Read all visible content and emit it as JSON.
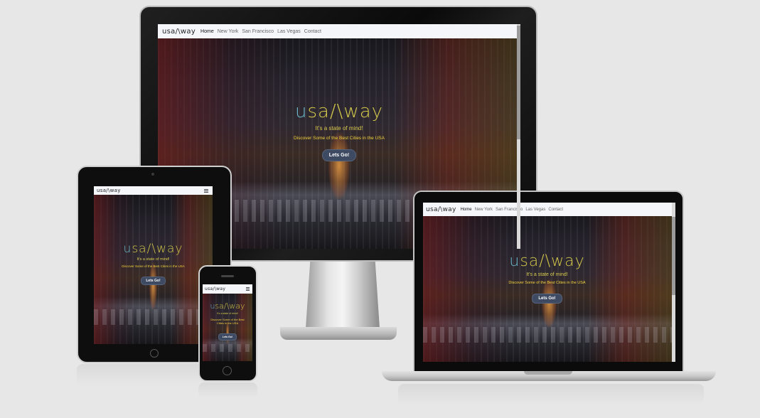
{
  "site": {
    "brand": "usa/\\way",
    "brand_prefix": "u",
    "brand_rest": "sa/\\way",
    "nav": [
      "Home",
      "New York",
      "San Francisco",
      "Las Vegas",
      "Contact"
    ],
    "hero": {
      "title_prefix": "u",
      "title_rest": "sa/\\way",
      "tagline": "It's a state of mind!",
      "discover": "Discover Some of the Best Cities in the USA",
      "discover_phone": "Discover Some of the Best Cities in the USA",
      "cta": "Lets Go!"
    }
  },
  "colors": {
    "accent_title": "#d4c94a",
    "accent_u": "#6ab9c9",
    "discover": "#f2d23c",
    "cta_bg": "#3e4a62",
    "navbar_bg": "#f4f6f9"
  },
  "icons": {
    "menu": "hamburger-icon",
    "camera": "camera-icon",
    "home_button": "home-button-icon"
  }
}
